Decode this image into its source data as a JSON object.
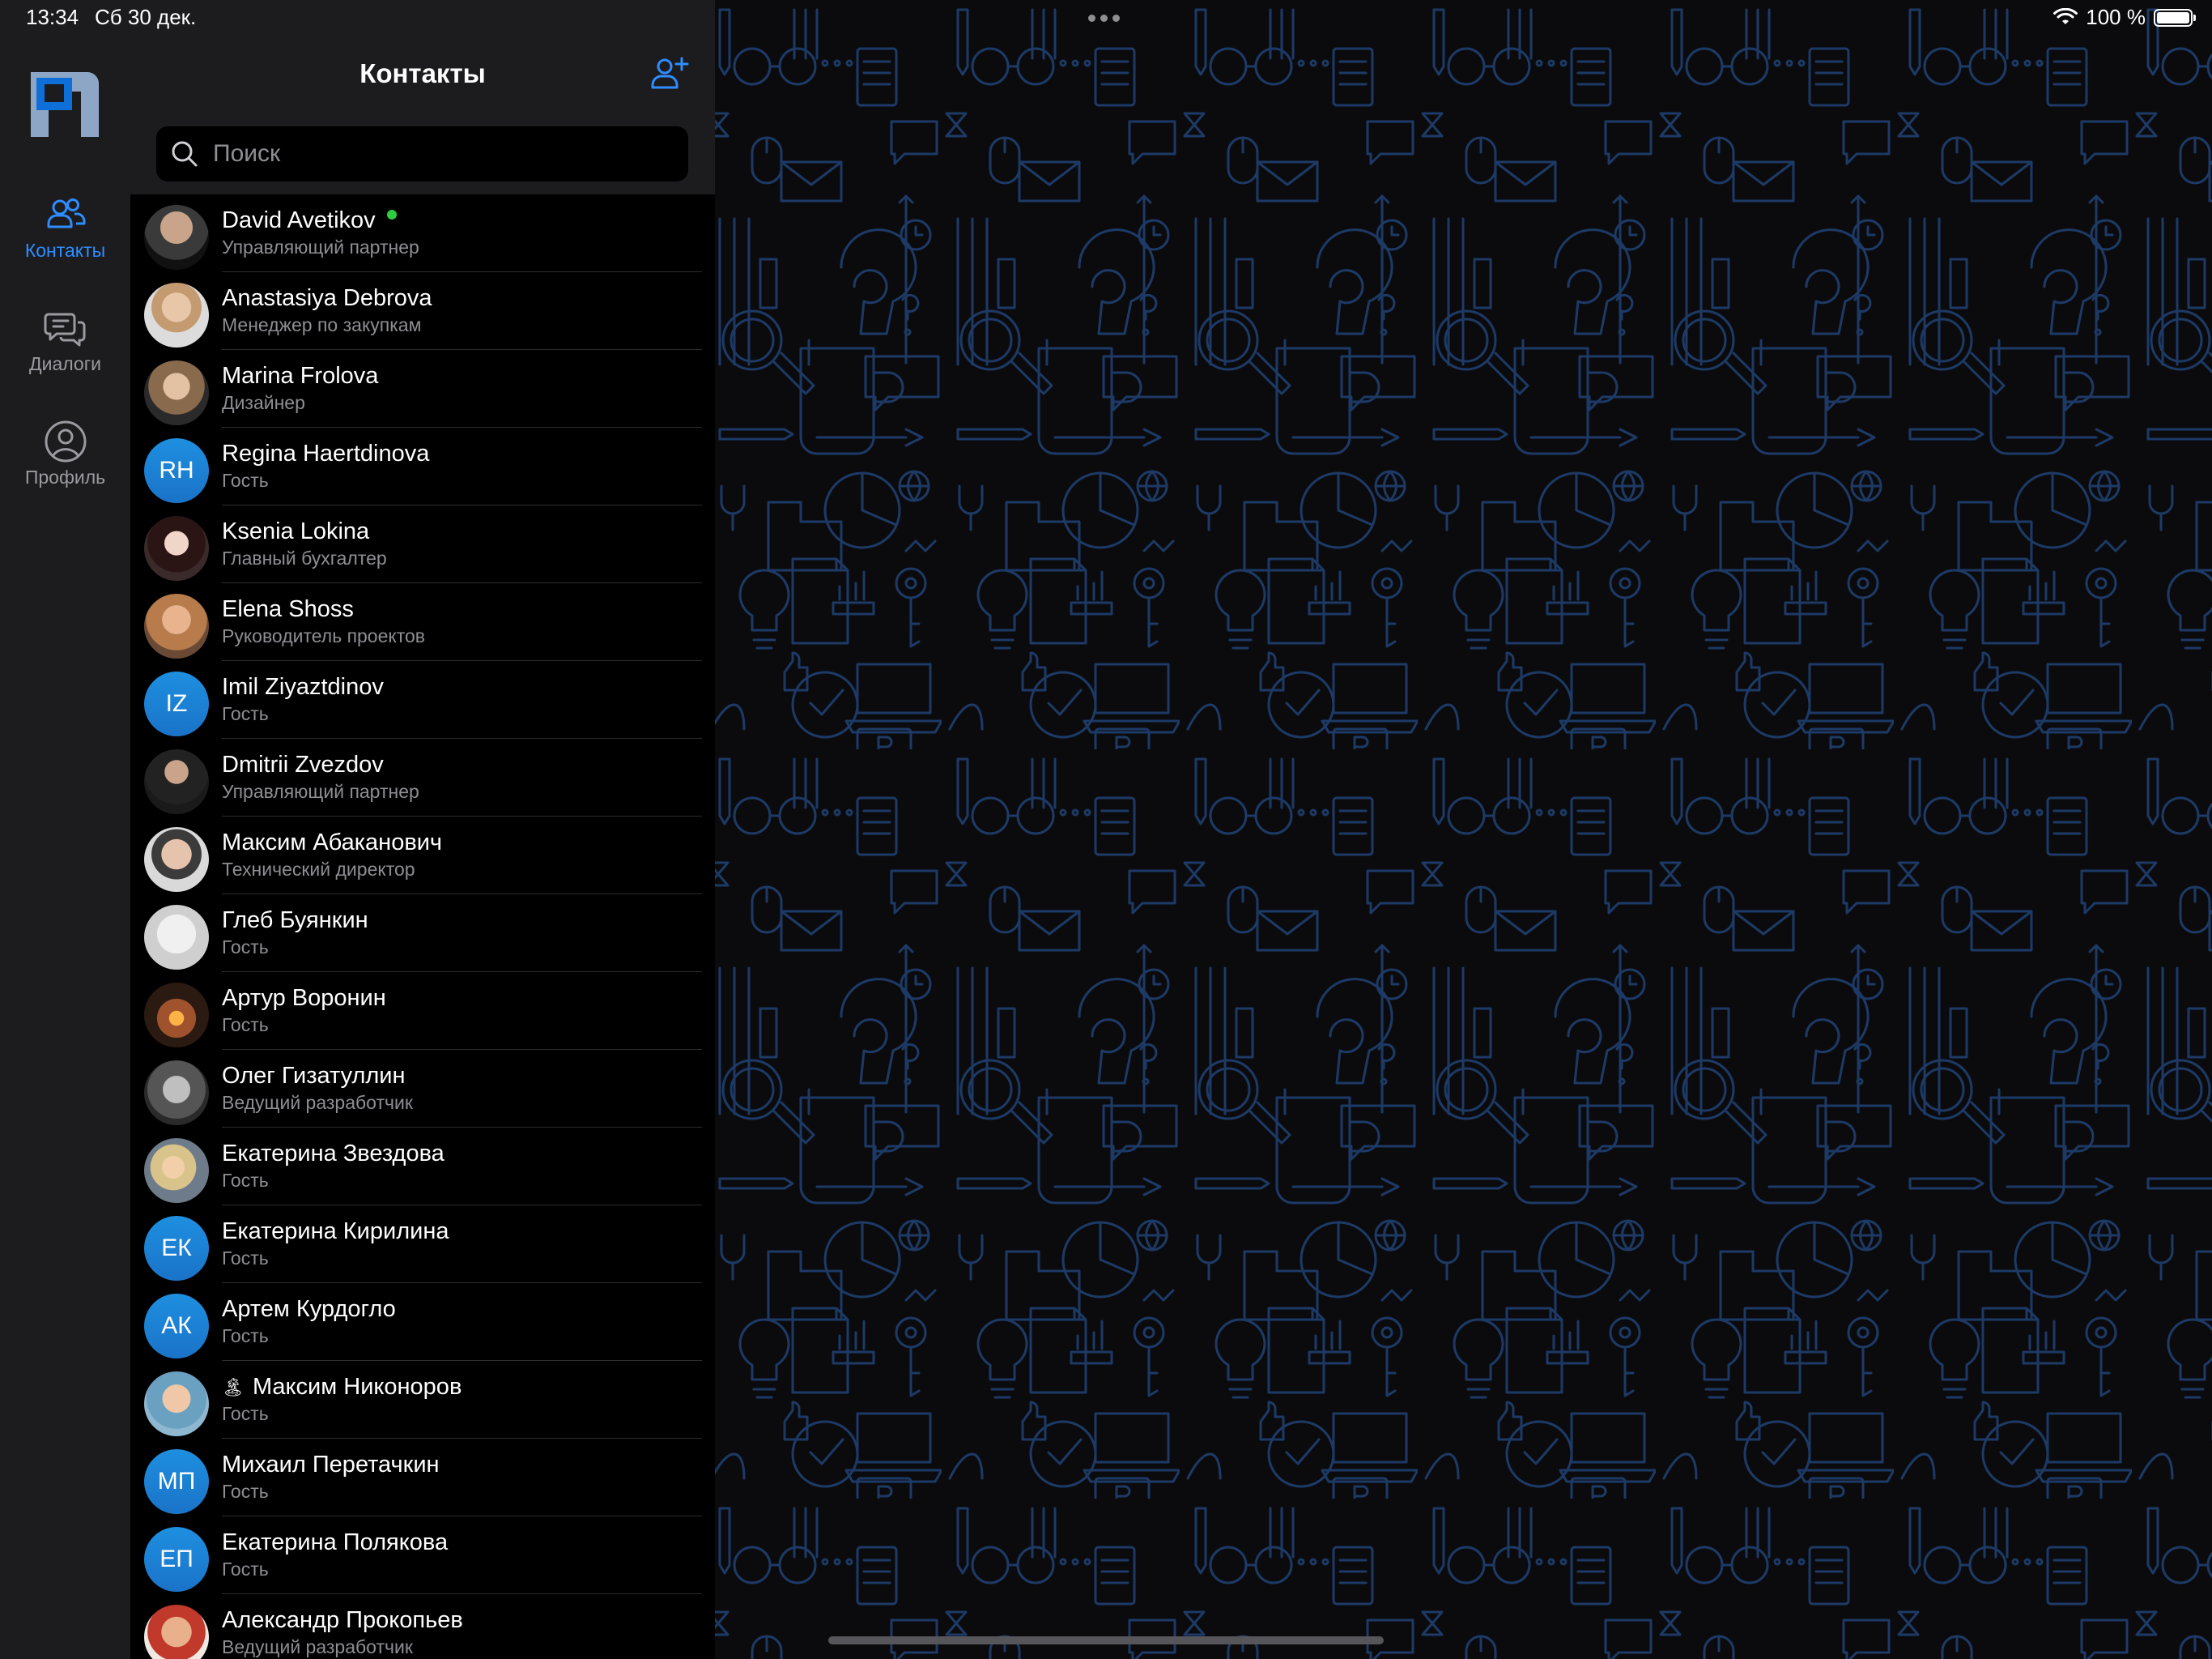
{
  "status_bar": {
    "time": "13:34",
    "date": "Сб 30 дек.",
    "battery": "100 %",
    "battery_level": 1.0
  },
  "rail": {
    "items": [
      {
        "label": "Контакты",
        "icon": "contacts-icon",
        "active": true
      },
      {
        "label": "Диалоги",
        "icon": "dialogs-icon",
        "active": false
      },
      {
        "label": "Профиль",
        "icon": "profile-icon",
        "active": false
      }
    ]
  },
  "contacts": {
    "title": "Контакты",
    "search_placeholder": "Поиск",
    "search_value": "",
    "items": [
      {
        "name": "David Avetikov",
        "role": "Управляющий партнер",
        "avatar": "photo",
        "online": true
      },
      {
        "name": "Anastasiya Debrova",
        "role": "Менеджер по закупкам",
        "avatar": "photo"
      },
      {
        "name": "Marina Frolova",
        "role": "Дизайнер",
        "avatar": "photo"
      },
      {
        "name": "Regina Haertdinova",
        "role": "Гость",
        "avatar": "initials",
        "initials": "RH"
      },
      {
        "name": "Ksenia Lokina",
        "role": "Главный бухгалтер",
        "avatar": "photo"
      },
      {
        "name": "Elena Shoss",
        "role": "Руководитель проектов",
        "avatar": "photo"
      },
      {
        "name": "Imil Ziyaztdinov",
        "role": "Гость",
        "avatar": "initials",
        "initials": "IZ"
      },
      {
        "name": "Dmitrii Zvezdov",
        "role": "Управляющий партнер",
        "avatar": "photo"
      },
      {
        "name": "Максим Абаканович",
        "role": "Технический директор",
        "avatar": "photo"
      },
      {
        "name": "Глеб Буянкин",
        "role": "Гость",
        "avatar": "photo"
      },
      {
        "name": "Артур Воронин",
        "role": "Гость",
        "avatar": "photo"
      },
      {
        "name": "Олег Гизатуллин",
        "role": "Ведущий разработчик",
        "avatar": "photo"
      },
      {
        "name": "Екатерина Звездова",
        "role": "Гость",
        "avatar": "photo"
      },
      {
        "name": "Екатерина Кирилина",
        "role": "Гость",
        "avatar": "initials",
        "initials": "ЕК"
      },
      {
        "name": "Артем Курдогло",
        "role": "Гость",
        "avatar": "initials",
        "initials": "АК"
      },
      {
        "name": "Максим Никоноров",
        "role": "Гость",
        "avatar": "photo",
        "status_emoji": "🏝"
      },
      {
        "name": "Михаил Перетачкин",
        "role": "Гость",
        "avatar": "initials",
        "initials": "МП"
      },
      {
        "name": "Екатерина Полякова",
        "role": "Гость",
        "avatar": "initials",
        "initials": "ЕП"
      },
      {
        "name": "Александр Прокопьев",
        "role": "Ведущий разработчик",
        "avatar": "photo"
      }
    ]
  },
  "colors": {
    "accent": "#2f8cff",
    "panel_bg": "#1c1c1e",
    "list_bg": "#000000",
    "pattern_stroke": "#1d3a66",
    "online": "#2ecc40"
  }
}
